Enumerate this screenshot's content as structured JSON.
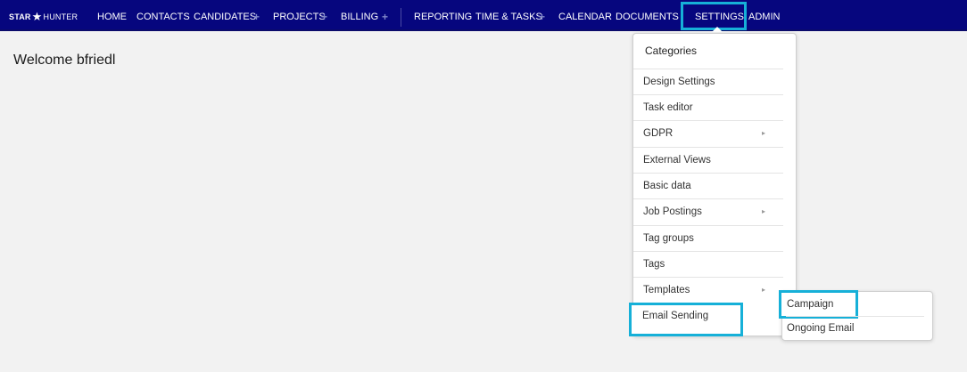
{
  "logo": {
    "star": "STAR",
    "glyph": "★",
    "hunter": "HUNTER"
  },
  "nav": {
    "home": "HOME",
    "contacts": "CONTACTS",
    "candidates": "CANDIDATES",
    "projects": "PROJECTS",
    "billing": "BILLING",
    "reporting": "REPORTING",
    "time_tasks": "TIME & TASKS",
    "calendar": "CALENDAR",
    "documents": "DOCUMENTS",
    "settings": "SETTINGS",
    "admin": "ADMIN",
    "plus": "+"
  },
  "main": {
    "welcome": "Welcome bfriedl"
  },
  "settings_menu": {
    "header": "Categories",
    "items": [
      {
        "label": "Design Settings",
        "has_submenu": false
      },
      {
        "label": "Task editor",
        "has_submenu": false
      },
      {
        "label": "GDPR",
        "has_submenu": true
      },
      {
        "label": "External Views",
        "has_submenu": false
      },
      {
        "label": "Basic data",
        "has_submenu": false
      },
      {
        "label": "Job Postings",
        "has_submenu": true
      },
      {
        "label": "Tag groups",
        "has_submenu": false
      },
      {
        "label": "Tags",
        "has_submenu": false
      },
      {
        "label": "Templates",
        "has_submenu": true
      },
      {
        "label": "Email Sending",
        "has_submenu": false
      }
    ],
    "chevron": "▸"
  },
  "email_submenu": {
    "items": [
      {
        "label": "Campaign"
      },
      {
        "label": "Ongoing Email"
      }
    ]
  },
  "colors": {
    "nav_background": "#06067e",
    "highlight": "#16b0d8",
    "page_background": "#f2f2f2"
  }
}
